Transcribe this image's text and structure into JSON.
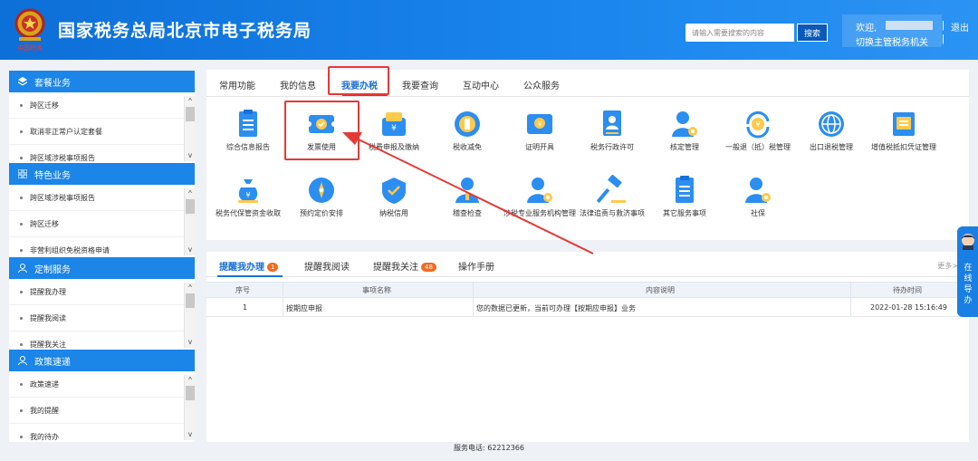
{
  "header": {
    "title": "国家税务总局北京市电子税务局",
    "emblem_caption": "中国税务",
    "search_placeholder": "请输入需要搜索的内容",
    "search_button": "搜索",
    "welcome": "欢迎,",
    "switch_org": "切换主管税务机关",
    "separator": "|",
    "logout": "退出"
  },
  "sidebar": {
    "panels": [
      {
        "title": "套餐业务",
        "icon": "package-icon",
        "items": [
          "跨区迁移",
          "取消非正常户认定套餐",
          "跨区域涉税事项报告"
        ]
      },
      {
        "title": "特色业务",
        "icon": "grid-icon",
        "items": [
          "跨区域涉税事项报告",
          "跨区迁移",
          "非营利组织免税资格申请"
        ]
      },
      {
        "title": "定制服务",
        "icon": "user-icon",
        "items": [
          "提醒我办理",
          "提醒我阅读",
          "提醒我关注"
        ]
      },
      {
        "title": "政策速递",
        "icon": "user-icon",
        "items": [
          "政策速递",
          "我的提醒",
          "我的待办"
        ]
      }
    ]
  },
  "main": {
    "tabs": [
      "常用功能",
      "我的信息",
      "我要办税",
      "我要查询",
      "互动中心",
      "公众服务"
    ],
    "active_tab": "我要办税",
    "functions_row1": [
      {
        "label": "综合信息报告",
        "icon": "report-icon"
      },
      {
        "label": "发票使用",
        "icon": "invoice-icon"
      },
      {
        "label": "税费申报及缴纳",
        "icon": "wallet-icon"
      },
      {
        "label": "税收减免",
        "icon": "tax-relief-icon"
      },
      {
        "label": "证明开具",
        "icon": "certificate-icon"
      },
      {
        "label": "税务行政许可",
        "icon": "license-icon"
      },
      {
        "label": "核定管理",
        "icon": "verify-user-icon"
      },
      {
        "label": "一般退（抵）税管理",
        "icon": "refund-icon"
      },
      {
        "label": "出口退税管理",
        "icon": "globe-icon"
      },
      {
        "label": "增值税抵扣凭证管理",
        "icon": "vat-icon"
      }
    ],
    "functions_row2": [
      {
        "label": "税务代保管资金收取",
        "icon": "money-bag-icon"
      },
      {
        "label": "预约定价安排",
        "icon": "compass-icon"
      },
      {
        "label": "纳税信用",
        "icon": "credit-icon"
      },
      {
        "label": "稽查检查",
        "icon": "inspector-icon"
      },
      {
        "label": "涉税专业服务机构管理",
        "icon": "agency-user-icon"
      },
      {
        "label": "法律追责与救济事项",
        "icon": "gavel-icon"
      },
      {
        "label": "其它服务事项",
        "icon": "list-icon"
      },
      {
        "label": "社保",
        "icon": "social-security-icon"
      }
    ]
  },
  "reminders": {
    "tabs": [
      {
        "label": "提醒我办理",
        "badge": "1"
      },
      {
        "label": "提醒我阅读",
        "badge": ""
      },
      {
        "label": "提醒我关注",
        "badge": "48"
      },
      {
        "label": "操作手册",
        "badge": ""
      }
    ],
    "more": "更多>",
    "columns": [
      "序号",
      "事项名称",
      "内容说明",
      "待办时间"
    ],
    "rows": [
      {
        "index": "1",
        "name": "按期应申报",
        "desc": "您的数据已更新，当前可办理【按期应申报】业务",
        "time": "2022-01-28 15:16:49"
      }
    ]
  },
  "footer": {
    "service_phone": "服务电话: 62212366"
  },
  "guide": {
    "text": "在线导办"
  },
  "colors": {
    "header_blue": "#1a86ee",
    "accent_blue": "#1a6fd8",
    "highlight_red": "#e53935",
    "badge_orange": "#f26b22"
  }
}
